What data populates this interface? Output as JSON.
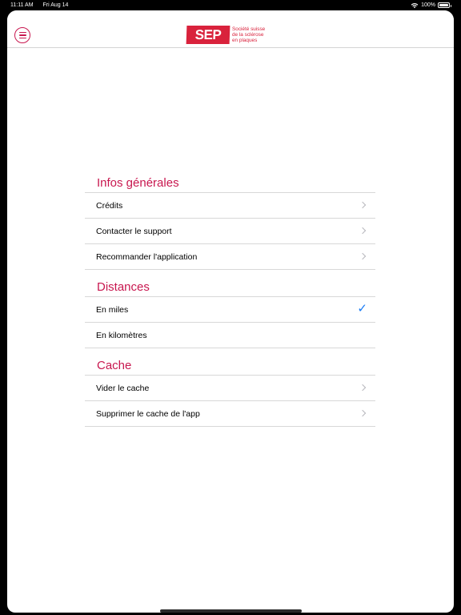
{
  "status": {
    "time": "11:11 AM",
    "date": "Fri Aug 14",
    "battery": "100%",
    "battery_level": 1.0,
    "wifi_icon": "wifi-icon"
  },
  "header": {
    "logo_text": "SEP",
    "logo_sub": [
      "Société suisse",
      "de la sclérose",
      "en plaques"
    ],
    "brand_color": "#d9223c",
    "menu_icon": "hamburger-menu-icon"
  },
  "sections": {
    "general": {
      "title": "Infos générales",
      "items": [
        {
          "label": "Crédits"
        },
        {
          "label": "Contacter le support"
        },
        {
          "label": "Recommander l'application"
        }
      ]
    },
    "distances": {
      "title": "Distances",
      "items": [
        {
          "label": "En miles",
          "selected": true
        },
        {
          "label": "En kilomètres",
          "selected": false
        }
      ]
    },
    "cache": {
      "title": "Cache",
      "items": [
        {
          "label": "Vider le cache"
        },
        {
          "label": "Supprimer le cache de l'app"
        }
      ]
    }
  },
  "colors": {
    "accent": "#c8174f",
    "check": "#1a7cf5"
  }
}
